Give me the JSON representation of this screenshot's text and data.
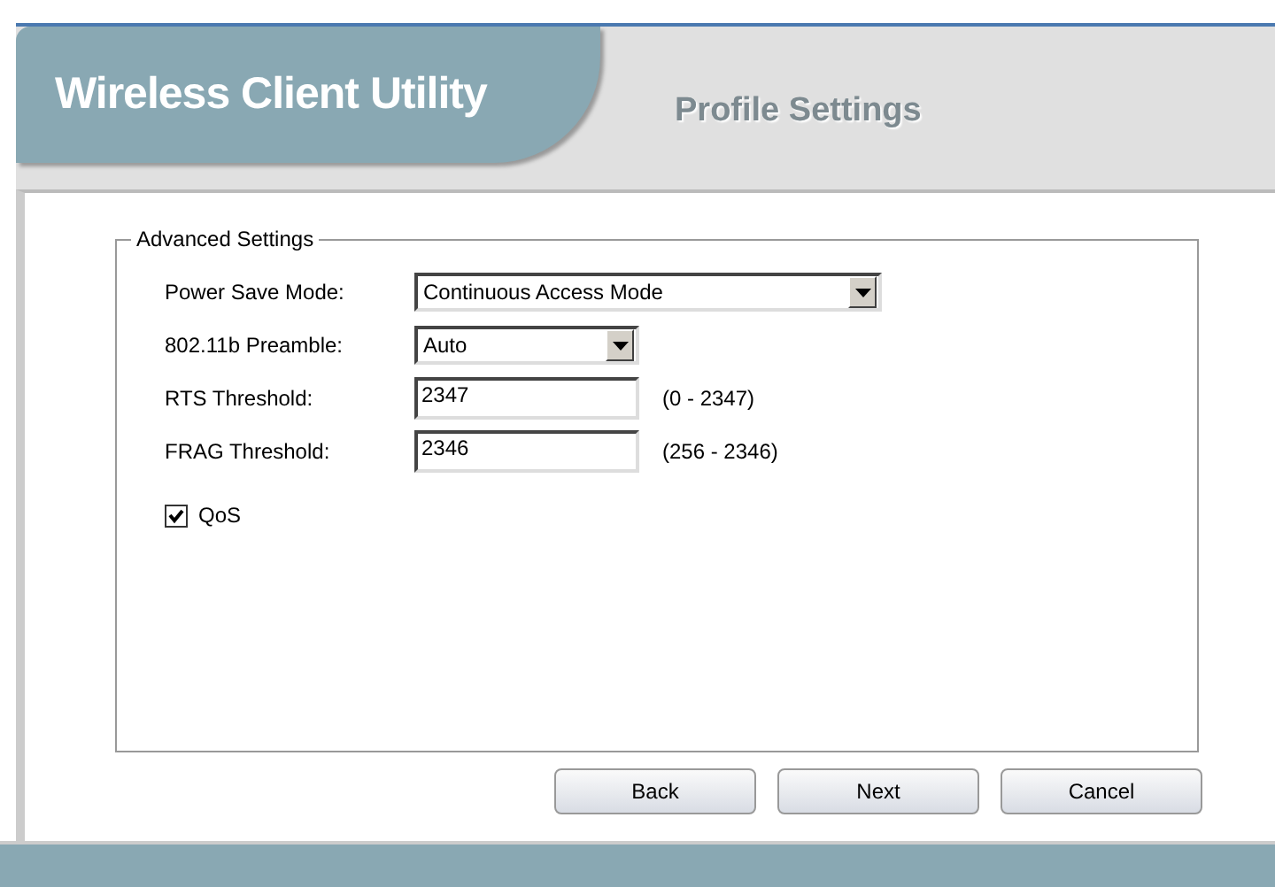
{
  "header": {
    "title": "Wireless Client Utility",
    "section": "Profile Settings"
  },
  "group": {
    "legend": "Advanced Settings",
    "fields": [
      {
        "kind": "select",
        "label": "Power Save Mode:",
        "value": "Continuous Access Mode"
      },
      {
        "kind": "select",
        "label": "802.11b Preamble:",
        "value": "Auto"
      },
      {
        "kind": "text",
        "label": "RTS Threshold:",
        "value": "2347",
        "hint": "(0 - 2347)"
      },
      {
        "kind": "text",
        "label": "FRAG Threshold:",
        "value": "2346",
        "hint": "(256 - 2346)"
      }
    ],
    "qos": {
      "label": "QoS",
      "checked": true
    }
  },
  "buttons": [
    "Back",
    "Next",
    "Cancel"
  ]
}
